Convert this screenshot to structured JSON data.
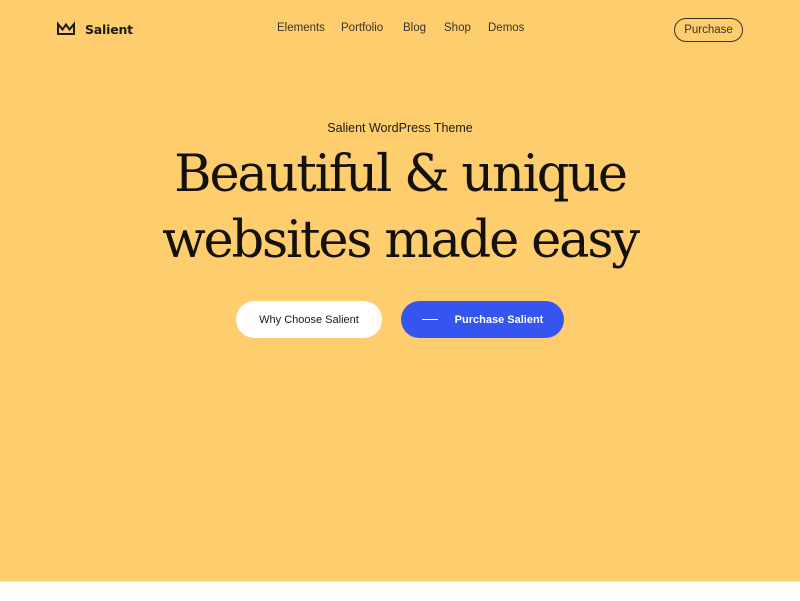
{
  "brand": {
    "name": "Salient",
    "icon": "crown-icon"
  },
  "nav": {
    "items": [
      "Elements",
      "Portfolio",
      "Blog",
      "Shop",
      "Demos"
    ]
  },
  "header": {
    "purchase_label": "Purchase"
  },
  "hero": {
    "eyebrow": "Salient WordPress Theme",
    "headline_line1": "Beautiful & unique",
    "headline_line2": "websites made easy",
    "primary_button": "Why Choose Salient",
    "secondary_button": "Purchase Salient",
    "secondary_button_icon": "dash-line-icon"
  },
  "colors": {
    "hero_bg": "#fecd6e",
    "accent_blue": "#3555f0",
    "text_dark": "#14110c"
  }
}
